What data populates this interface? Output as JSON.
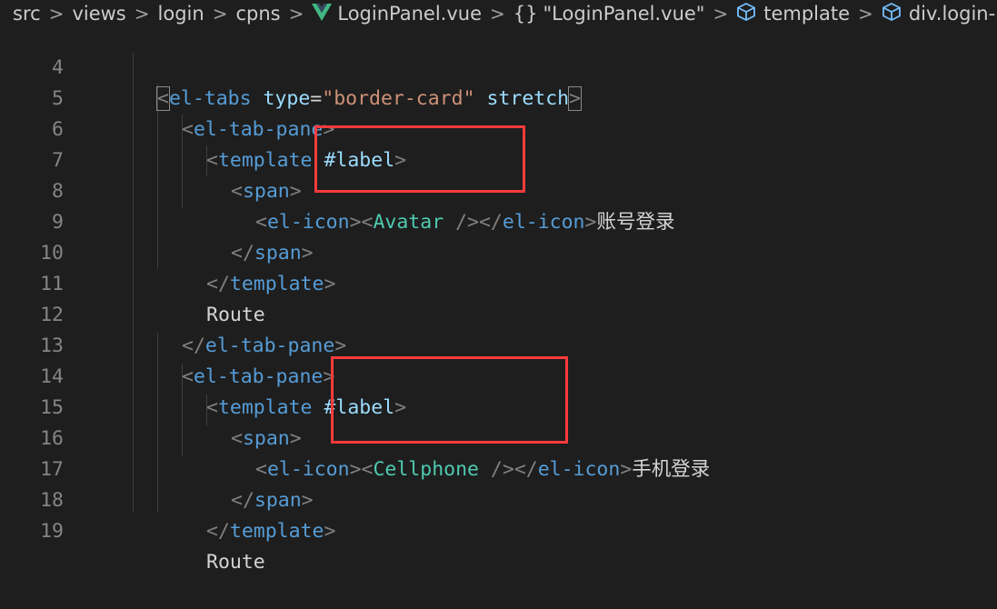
{
  "breadcrumb": {
    "items": [
      "src",
      "views",
      "login",
      "cpns",
      "LoginPanel.vue",
      "\"LoginPanel.vue\"",
      "template",
      "div.login-p"
    ],
    "separator": ">",
    "braces": "{}"
  },
  "editor": {
    "line_numbers": [
      "4",
      "5",
      "6",
      "7",
      "8",
      "9",
      "10",
      "11",
      "12",
      "13",
      "14",
      "15",
      "16",
      "17",
      "18",
      "19"
    ],
    "code": {
      "el_tabs": "el-tabs",
      "type_attr": "type",
      "eq": "=",
      "type_value": "\"border-card\"",
      "stretch": "stretch",
      "el_tab_pane": "el-tab-pane",
      "template": "template",
      "label_attr": "#label",
      "span": "span",
      "el_icon": "el-icon",
      "avatar": "Avatar",
      "cellphone": "Cellphone",
      "slash": "/",
      "lt": "<",
      "gt": ">",
      "lt_slash": "</",
      "self_close": "/>",
      "tab1_text": "账号登录",
      "tab2_text": "手机登录",
      "route": "Route"
    }
  },
  "colors": {
    "background": "#1e1e1e",
    "tag": "#569cd6",
    "attribute": "#9cdcfe",
    "string": "#ce9178",
    "component": "#4ec9b0",
    "highlight_box": "#ff3b3b",
    "vue_logo": "#41b883"
  }
}
